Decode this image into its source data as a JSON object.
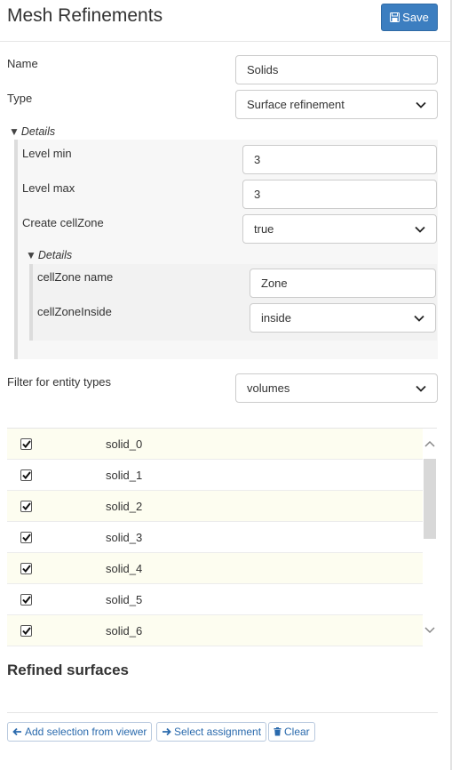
{
  "header": {
    "title": "Mesh Refinements",
    "save_label": "Save"
  },
  "form": {
    "name_label": "Name",
    "name_value": "Solids",
    "type_label": "Type",
    "type_value": "Surface refinement",
    "details_label": "Details",
    "level_min_label": "Level min",
    "level_min_value": "3",
    "level_max_label": "Level max",
    "level_max_value": "3",
    "create_cellzone_label": "Create cellZone",
    "create_cellzone_value": "true",
    "inner_details_label": "Details",
    "cellzone_name_label": "cellZone name",
    "cellzone_name_value": "Zone",
    "cellzone_inside_label": "cellZoneInside",
    "cellzone_inside_value": "inside",
    "filter_label": "Filter for entity types",
    "filter_value": "volumes"
  },
  "entities": [
    {
      "label": "solid_0",
      "checked": true
    },
    {
      "label": "solid_1",
      "checked": true
    },
    {
      "label": "solid_2",
      "checked": true
    },
    {
      "label": "solid_3",
      "checked": true
    },
    {
      "label": "solid_4",
      "checked": true
    },
    {
      "label": "solid_5",
      "checked": true
    },
    {
      "label": "solid_6",
      "checked": true
    }
  ],
  "refined": {
    "title": "Refined surfaces",
    "add_selection_label": "Add selection from viewer",
    "select_assignment_label": "Select assignment",
    "clear_label": "Clear"
  },
  "colors": {
    "accent": "#3c7ec0",
    "link": "#2a6aad"
  },
  "icons": [
    "save-icon",
    "chevron-down-icon",
    "arrow-left-icon",
    "arrow-right-icon",
    "trash-icon",
    "checkmark-icon"
  ]
}
